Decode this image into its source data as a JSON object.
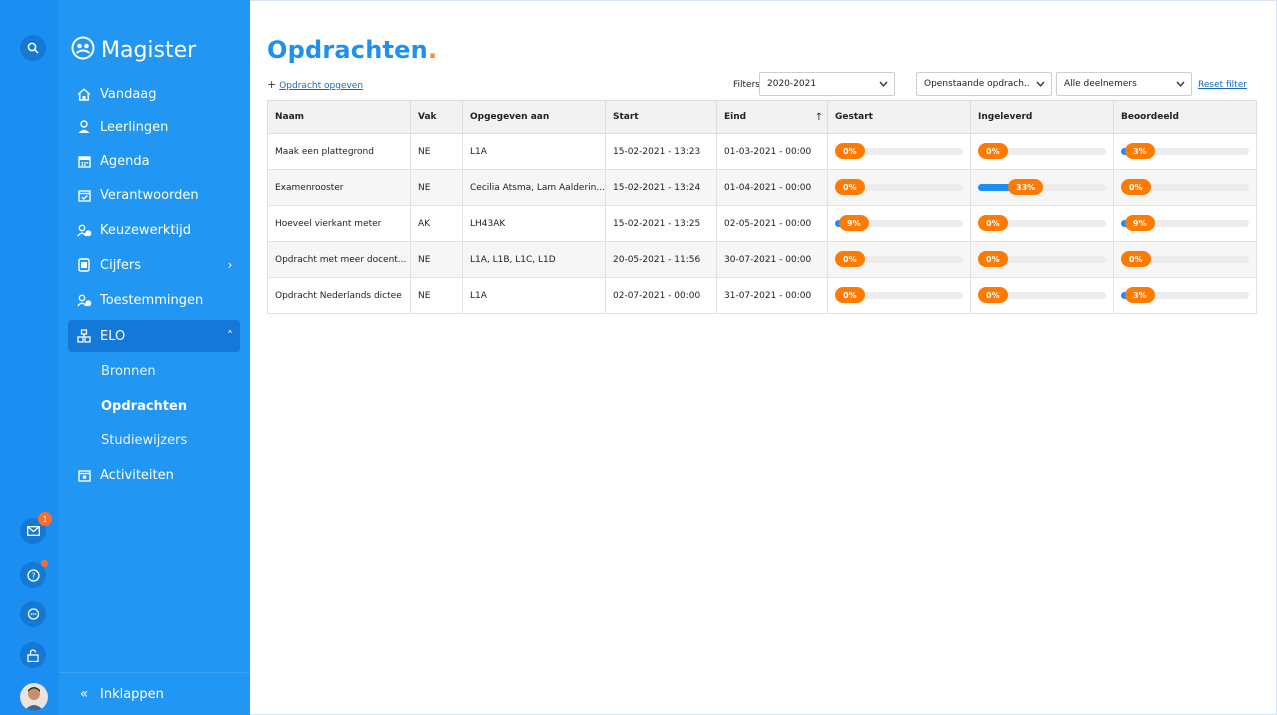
{
  "sidebar": {
    "brand": "Magister",
    "items": [
      {
        "label": "Vandaag",
        "icon": "home-icon"
      },
      {
        "label": "Leerlingen",
        "icon": "students-icon"
      },
      {
        "label": "Agenda",
        "icon": "calendar-icon"
      },
      {
        "label": "Verantwoorden",
        "icon": "calendar-check-icon"
      },
      {
        "label": "Keuzewerktijd",
        "icon": "user-settings-icon"
      },
      {
        "label": "Cijfers",
        "icon": "grades-icon"
      },
      {
        "label": "Toestemmingen",
        "icon": "user-permission-icon"
      },
      {
        "label": "ELO",
        "icon": "elo-icon"
      }
    ],
    "elo_sub": [
      "Bronnen",
      "Opdrachten",
      "Studiewijzers"
    ],
    "activities": "Activiteiten",
    "collapse": "Inklappen",
    "mail_badge": "1"
  },
  "main": {
    "title": "Opdrachten",
    "title_dot": ".",
    "add_link": "Opdracht opgeven",
    "filters_label": "Filters:",
    "filter_year": "2020-2021",
    "filter_status": "Openstaande opdrach...",
    "filter_participants": "Alle deelnemers",
    "reset": "Reset filter"
  },
  "table": {
    "headers": [
      "Naam",
      "Vak",
      "Opgegeven aan",
      "Start",
      "Eind",
      "Gestart",
      "Ingeleverd",
      "Beoordeeld"
    ],
    "rows": [
      {
        "naam": "Maak een plattegrond",
        "vak": "NE",
        "aan": "L1A",
        "start": "15-02-2021 - 13:23",
        "eind": "01-03-2021 - 00:00",
        "gestart": 0,
        "ingeleverd": 0,
        "beoordeeld": 3
      },
      {
        "naam": "Examenrooster",
        "vak": "NE",
        "aan": "Cecilia Atsma, Lam Aalderin...",
        "start": "15-02-2021 - 13:24",
        "eind": "01-04-2021 - 00:00",
        "gestart": 0,
        "ingeleverd": 33,
        "beoordeeld": 0
      },
      {
        "naam": "Hoeveel vierkant meter",
        "vak": "AK",
        "aan": "LH43AK",
        "start": "15-02-2021 - 13:25",
        "eind": "02-05-2021 - 00:00",
        "gestart": 9,
        "ingeleverd": 0,
        "beoordeeld": 9
      },
      {
        "naam": "Opdracht met meer docent...",
        "vak": "NE",
        "aan": "L1A, L1B, L1C, L1D",
        "start": "20-05-2021 - 11:56",
        "eind": "30-07-2021 - 00:00",
        "gestart": 0,
        "ingeleverd": 0,
        "beoordeeld": 0
      },
      {
        "naam": "Opdracht Nederlands dictee",
        "vak": "NE",
        "aan": "L1A",
        "start": "02-07-2021 - 00:00",
        "eind": "31-07-2021 - 00:00",
        "gestart": 0,
        "ingeleverd": 0,
        "beoordeeld": 3
      }
    ]
  },
  "colors": {
    "accent": "#1e90ef",
    "orange": "#ff7a00",
    "sidebar": "#2196f3",
    "rail": "#1c8ef2"
  }
}
